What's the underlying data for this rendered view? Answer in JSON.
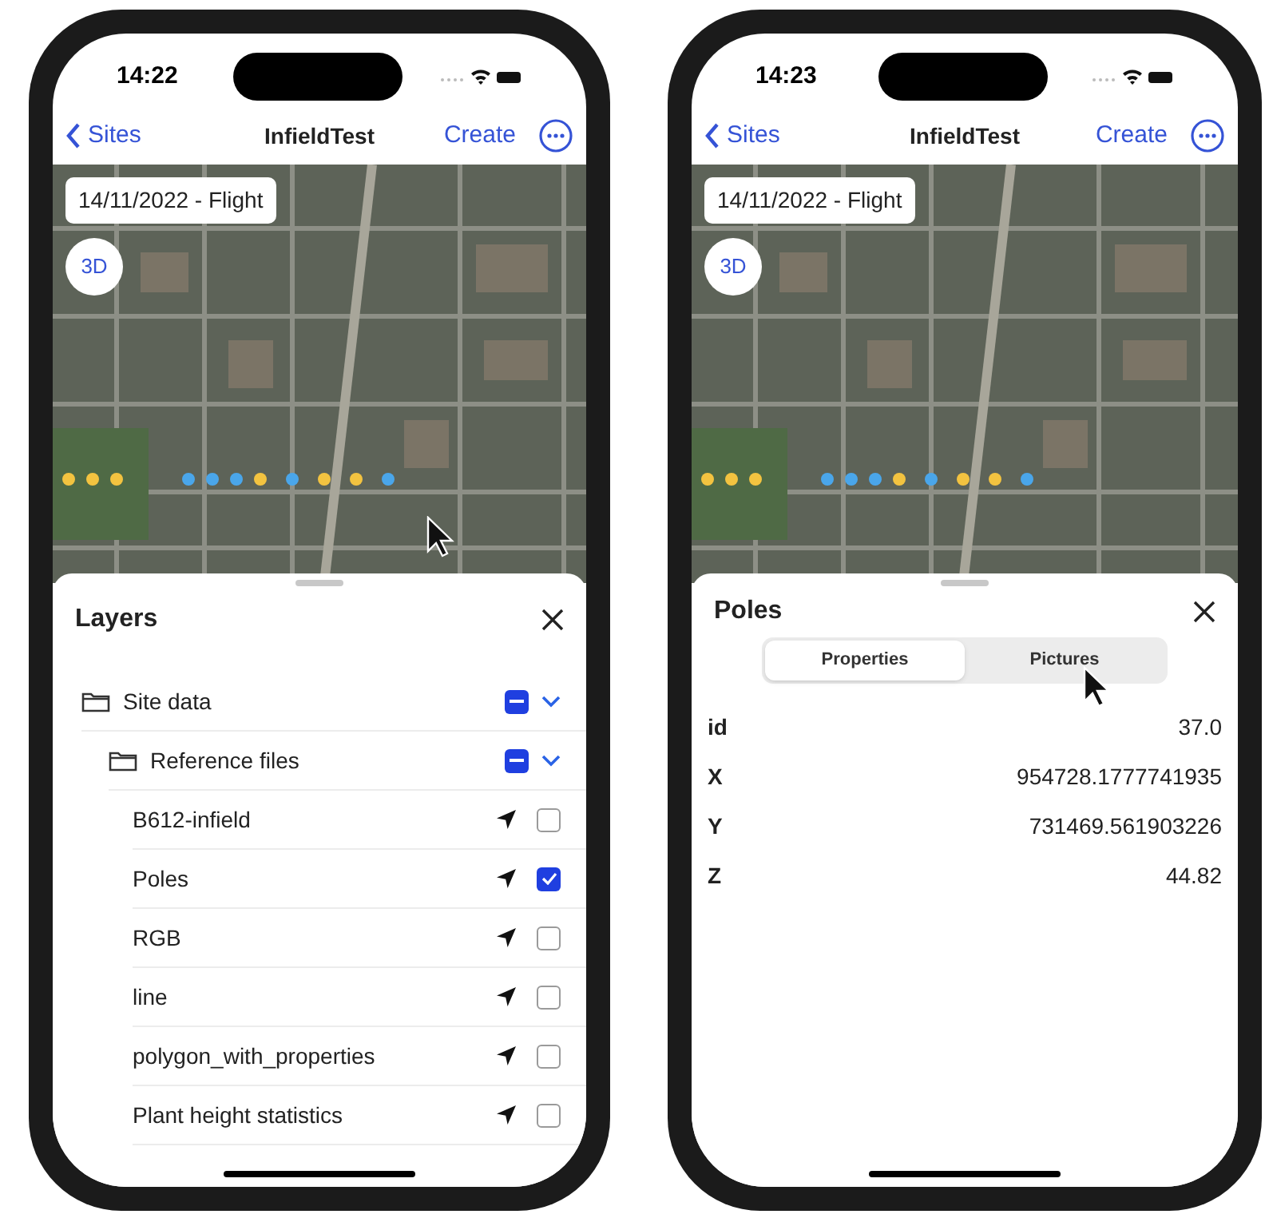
{
  "phones": [
    {
      "status_bar": {
        "time": "14:22"
      },
      "nav_bar": {
        "back": "Sites",
        "title": "InfieldTest",
        "action": "Create"
      },
      "map": {
        "date_label": "14/11/2022 - Flight",
        "view_button": "3D"
      },
      "sheet": {
        "kind": "layers",
        "title": "Layers",
        "tree": [
          {
            "label": "Site data",
            "kind": "folder",
            "indeterminate": true,
            "expanded": true,
            "children": [
              {
                "label": "Reference files",
                "kind": "folder",
                "indeterminate": true,
                "expanded": true,
                "children": [
                  {
                    "label": "B612-infield",
                    "kind": "layer",
                    "checked": false
                  },
                  {
                    "label": "Poles",
                    "kind": "layer",
                    "checked": true
                  },
                  {
                    "label": "RGB",
                    "kind": "layer",
                    "checked": false
                  },
                  {
                    "label": "line",
                    "kind": "layer",
                    "checked": false
                  },
                  {
                    "label": "polygon_with_properties",
                    "kind": "layer",
                    "checked": false
                  },
                  {
                    "label": "Plant height statistics",
                    "kind": "layer",
                    "checked": false
                  }
                ]
              }
            ]
          }
        ]
      }
    },
    {
      "status_bar": {
        "time": "14:23"
      },
      "nav_bar": {
        "back": "Sites",
        "title": "InfieldTest",
        "action": "Create"
      },
      "map": {
        "date_label": "14/11/2022 - Flight",
        "view_button": "3D"
      },
      "sheet": {
        "kind": "feature",
        "title": "Poles",
        "segments": [
          {
            "label": "Properties",
            "selected": true
          },
          {
            "label": "Pictures",
            "selected": false
          }
        ],
        "properties": [
          {
            "key": "id",
            "value": "37.0"
          },
          {
            "key": "X",
            "value": "954728.1777741935"
          },
          {
            "key": "Y",
            "value": "731469.561903226"
          },
          {
            "key": "Z",
            "value": "44.82"
          }
        ]
      }
    }
  ]
}
